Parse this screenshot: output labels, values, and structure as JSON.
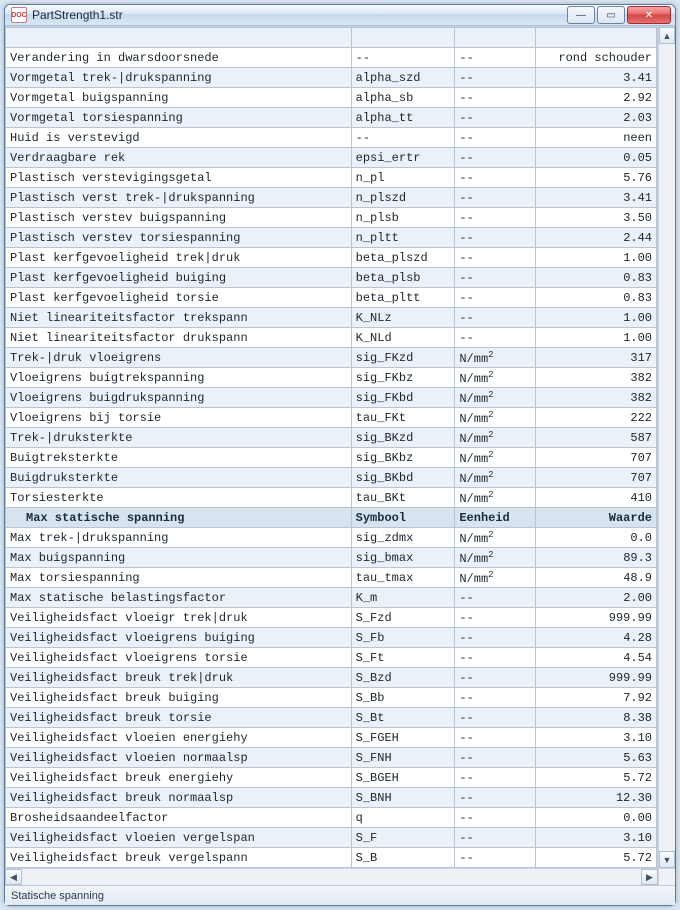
{
  "window": {
    "title": "PartStrength1.str",
    "icon_label": "DOC"
  },
  "status_bar": "Statische spanning",
  "section_header": {
    "label": "Max statische spanning",
    "symbol": "Symbool",
    "unit": "Eenheid",
    "value": "Waarde"
  },
  "rows_top": [
    {
      "label": "",
      "symbol": "",
      "unit": "",
      "value": ""
    },
    {
      "label": "Verandering in dwarsdoorsnede",
      "symbol": "--",
      "unit": "--",
      "value": "rond schouder"
    },
    {
      "label": "Vormgetal trek-|drukspanning",
      "symbol": "alpha_szd",
      "unit": "--",
      "value": "3.41"
    },
    {
      "label": "Vormgetal buigspanning",
      "symbol": "alpha_sb",
      "unit": "--",
      "value": "2.92"
    },
    {
      "label": "Vormgetal torsiespanning",
      "symbol": "alpha_tt",
      "unit": "--",
      "value": "2.03"
    },
    {
      "label": "Huid is verstevigd",
      "symbol": "--",
      "unit": "--",
      "value": "neen"
    },
    {
      "label": "Verdraagbare rek",
      "symbol": "epsi_ertr",
      "unit": "--",
      "value": "0.05"
    },
    {
      "label": "Plastisch verstevigingsgetal",
      "symbol": "n_pl",
      "unit": "--",
      "value": "5.76"
    },
    {
      "label": "Plastisch verst trek-|drukspanning",
      "symbol": "n_plszd",
      "unit": "--",
      "value": "3.41"
    },
    {
      "label": "Plastisch verstev buigspanning",
      "symbol": "n_plsb",
      "unit": "--",
      "value": "3.50"
    },
    {
      "label": "Plastisch verstev torsiespanning",
      "symbol": "n_pltt",
      "unit": "--",
      "value": "2.44"
    },
    {
      "label": "Plast kerfgevoeligheid trek|druk",
      "symbol": "beta_plszd",
      "unit": "--",
      "value": "1.00"
    },
    {
      "label": "Plast kerfgevoeligheid buiging",
      "symbol": "beta_plsb",
      "unit": "--",
      "value": "0.83"
    },
    {
      "label": "Plast kerfgevoeligheid torsie",
      "symbol": "beta_pltt",
      "unit": "--",
      "value": "0.83"
    },
    {
      "label": "Niet lineariteitsfactor trekspann",
      "symbol": "K_NLz",
      "unit": "--",
      "value": "1.00"
    },
    {
      "label": "Niet lineariteitsfactor drukspann",
      "symbol": "K_NLd",
      "unit": "--",
      "value": "1.00"
    },
    {
      "label": "Trek-|druk vloeigrens",
      "symbol": "sig_FKzd",
      "unit": "N/mm²",
      "value": "317"
    },
    {
      "label": "Vloeigrens buigtrekspanning",
      "symbol": "sig_FKbz",
      "unit": "N/mm²",
      "value": "382"
    },
    {
      "label": "Vloeigrens buigdrukspanning",
      "symbol": "sig_FKbd",
      "unit": "N/mm²",
      "value": "382"
    },
    {
      "label": "Vloeigrens bij torsie",
      "symbol": "tau_FKt",
      "unit": "N/mm²",
      "value": "222"
    },
    {
      "label": "Trek-|druksterkte",
      "symbol": "sig_BKzd",
      "unit": "N/mm²",
      "value": "587"
    },
    {
      "label": "Buigtreksterkte",
      "symbol": "sig_BKbz",
      "unit": "N/mm²",
      "value": "707"
    },
    {
      "label": "Buigdruksterkte",
      "symbol": "sig_BKbd",
      "unit": "N/mm²",
      "value": "707"
    },
    {
      "label": "Torsiesterkte",
      "symbol": "tau_BKt",
      "unit": "N/mm²",
      "value": "410"
    }
  ],
  "rows_bottom": [
    {
      "label": "Max trek-|drukspanning",
      "symbol": "sig_zdmx",
      "unit": "N/mm²",
      "value": "0.0"
    },
    {
      "label": "Max buigspanning",
      "symbol": "sig_bmax",
      "unit": "N/mm²",
      "value": "89.3"
    },
    {
      "label": "Max torsiespanning",
      "symbol": "tau_tmax",
      "unit": "N/mm²",
      "value": "48.9"
    },
    {
      "label": "Max statische belastingsfactor",
      "symbol": "K_m",
      "unit": "--",
      "value": "2.00"
    },
    {
      "label": "Veiligheidsfact vloeigr trek|druk",
      "symbol": "S_Fzd",
      "unit": "--",
      "value": "999.99"
    },
    {
      "label": "Veiligheidsfact vloeigrens buiging",
      "symbol": "S_Fb",
      "unit": "--",
      "value": "4.28"
    },
    {
      "label": "Veiligheidsfact vloeigrens torsie",
      "symbol": "S_Ft",
      "unit": "--",
      "value": "4.54"
    },
    {
      "label": "Veiligheidsfact breuk trek|druk",
      "symbol": "S_Bzd",
      "unit": "--",
      "value": "999.99"
    },
    {
      "label": "Veiligheidsfact breuk buiging",
      "symbol": "S_Bb",
      "unit": "--",
      "value": "7.92"
    },
    {
      "label": "Veiligheidsfact breuk torsie",
      "symbol": "S_Bt",
      "unit": "--",
      "value": "8.38"
    },
    {
      "label": "Veiligheidsfact vloeien energiehy",
      "symbol": "S_FGEH",
      "unit": "--",
      "value": "3.10"
    },
    {
      "label": "Veiligheidsfact vloeien normaalsp",
      "symbol": "S_FNH",
      "unit": "--",
      "value": "5.63"
    },
    {
      "label": "Veiligheidsfact breuk energiehy",
      "symbol": "S_BGEH",
      "unit": "--",
      "value": "5.72"
    },
    {
      "label": "Veiligheidsfact breuk normaalsp",
      "symbol": "S_BNH",
      "unit": "--",
      "value": "12.30"
    },
    {
      "label": "Brosheidsaandeelfactor",
      "symbol": "q",
      "unit": "--",
      "value": "0.00"
    },
    {
      "label": "Veiligheidsfact vloeien vergelspan",
      "symbol": "S_F",
      "unit": "--",
      "value": "3.10"
    },
    {
      "label": "Veiligheidsfact  breuk vergelspann",
      "symbol": "S_B",
      "unit": "--",
      "value": "5.72"
    }
  ]
}
